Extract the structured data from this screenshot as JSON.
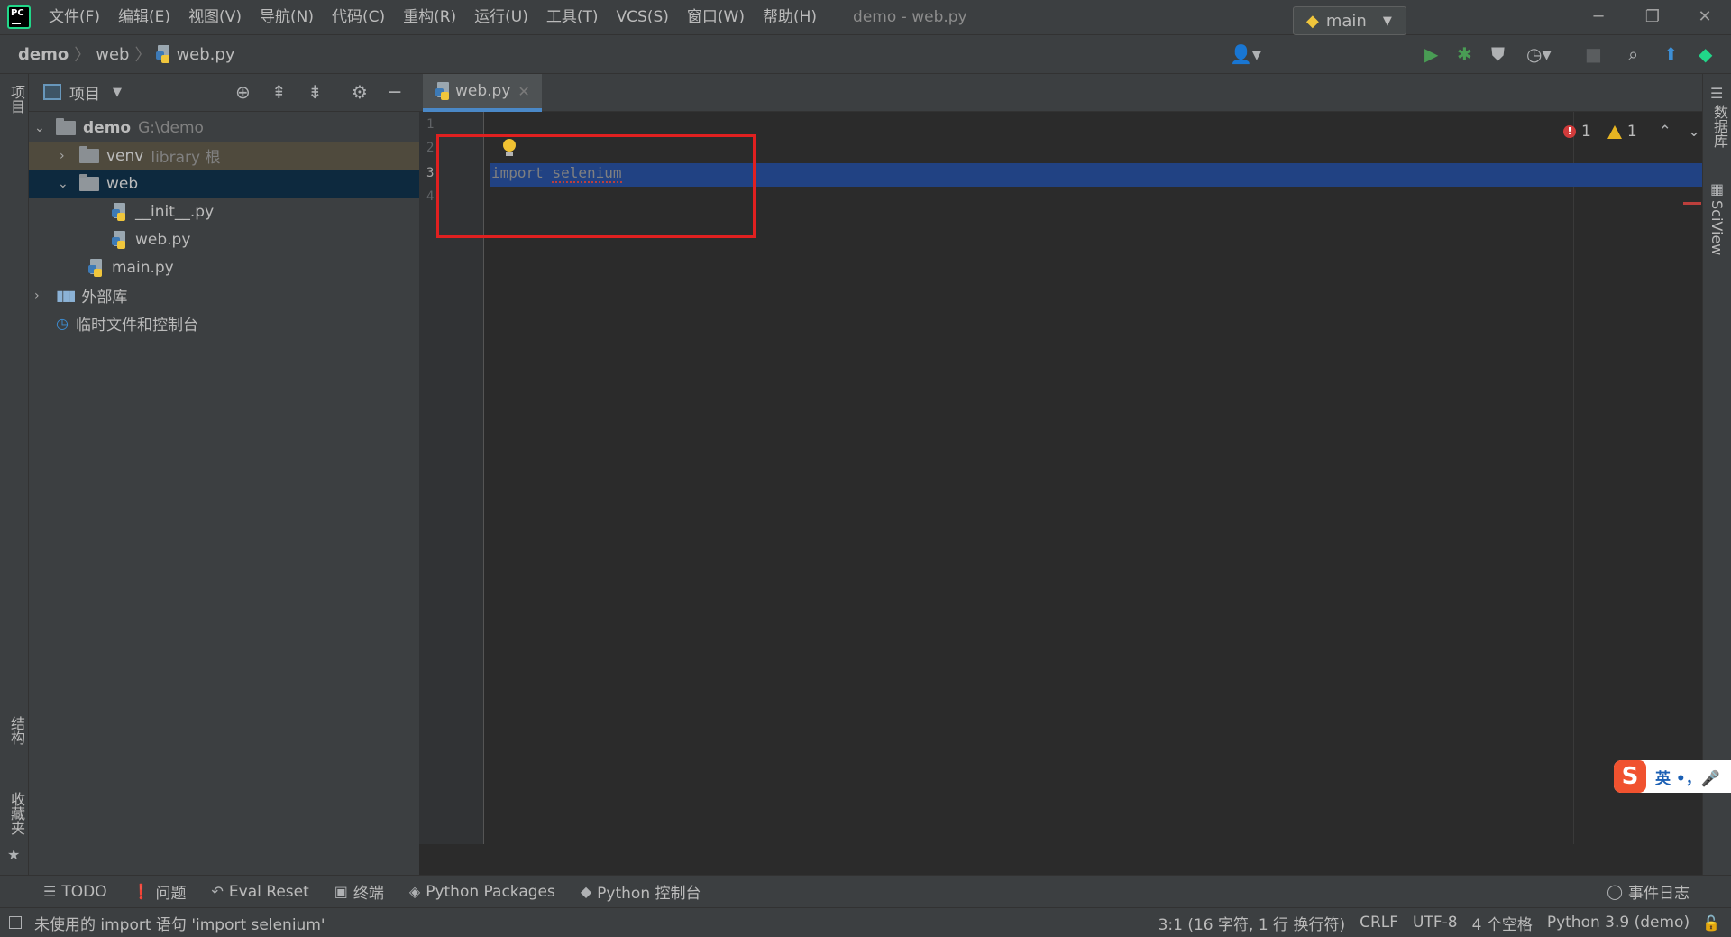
{
  "menu": {
    "items": [
      "文件(F)",
      "编辑(E)",
      "视图(V)",
      "导航(N)",
      "代码(C)",
      "重构(R)",
      "运行(U)",
      "工具(T)",
      "VCS(S)",
      "窗口(W)",
      "帮助(H)"
    ],
    "window_title": "demo - web.py"
  },
  "breadcrumb": {
    "project": "demo",
    "folder": "web",
    "file": "web.py"
  },
  "run_config": {
    "name": "main"
  },
  "project_panel": {
    "title": "项目",
    "tree": {
      "demo": {
        "name": "demo",
        "path": "G:\\demo"
      },
      "venv": {
        "name": "venv",
        "suffix": "library 根"
      },
      "web": {
        "name": "web"
      },
      "init": {
        "name": "__init__.py"
      },
      "webpy": {
        "name": "web.py"
      },
      "main": {
        "name": "main.py"
      },
      "external": {
        "name": "外部库"
      },
      "scratch": {
        "name": "临时文件和控制台"
      }
    }
  },
  "left_strip": {
    "project": "项目",
    "structure": "结构",
    "favorites": "收藏夹"
  },
  "right_strip": {
    "database": "数据库",
    "sciview": "SciView"
  },
  "editor": {
    "tab": "web.py",
    "line_numbers": [
      "1",
      "2",
      "3",
      "4"
    ],
    "code": {
      "keyword": "import",
      "module": "selenium"
    },
    "errors": "1",
    "warnings": "1"
  },
  "ime": {
    "logo": "S",
    "text": "英 •，🎤"
  },
  "tool_windows": [
    {
      "label": "TODO",
      "icon": "list-icon"
    },
    {
      "label": "问题",
      "icon": "problems-icon"
    },
    {
      "label": "Eval Reset",
      "icon": "reset-icon"
    },
    {
      "label": "终端",
      "icon": "terminal-icon"
    },
    {
      "label": "Python Packages",
      "icon": "packages-icon"
    },
    {
      "label": "Python 控制台",
      "icon": "python-console-icon"
    }
  ],
  "event_log": "事件日志",
  "status": {
    "message": "未使用的 import 语句 'import selenium'",
    "position": "3:1 (16 字符, 1 行 换行符)",
    "line_separator": "CRLF",
    "encoding": "UTF-8",
    "indent": "4 个空格",
    "interpreter": "Python 3.9 (demo)"
  },
  "colors": {
    "accent": "#4a88c7",
    "selection": "#214283",
    "annotation_box": "#e02020",
    "error": "#bc3f3c"
  }
}
